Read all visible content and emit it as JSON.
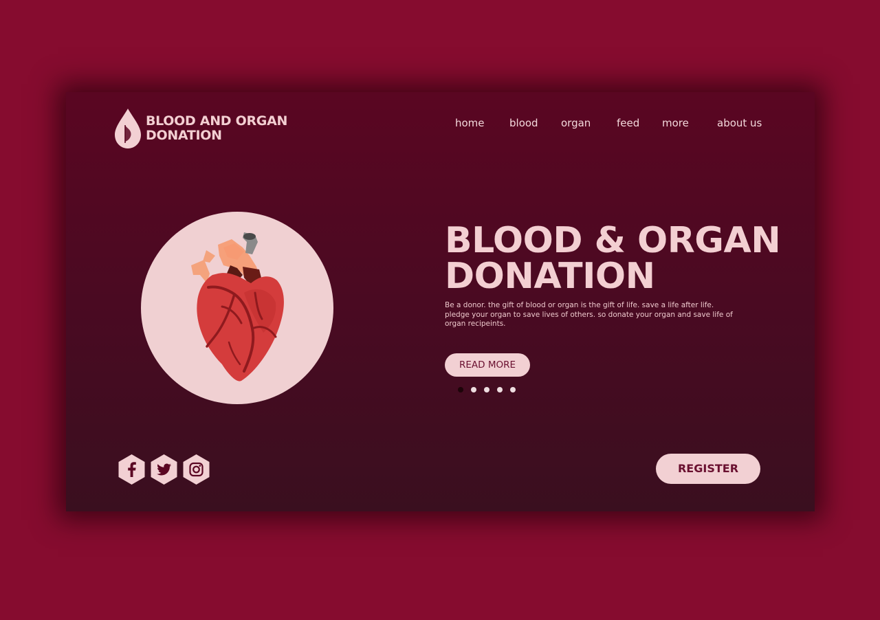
{
  "logo": {
    "line1": "BLOOD AND ORGAN",
    "line2": "DONATION",
    "icon": "blood-drop-icon"
  },
  "nav": {
    "items": [
      "home",
      "blood",
      "organ",
      "feed",
      "more",
      "about us"
    ]
  },
  "hero": {
    "illustration": "heart-icon",
    "title_line1": "BLOOD & ORGAN",
    "title_line2": "DONATION",
    "description": "Be a donor. the gift of blood or organ is the gift of life. save a life after life. pledge your organ to save lives of others. so donate your organ and save life of organ recipeints.",
    "read_more_label": "READ MORE",
    "carousel": {
      "total": 5,
      "active": 1
    }
  },
  "footer": {
    "social": [
      "facebook-icon",
      "twitter-icon",
      "instagram-icon"
    ],
    "register_label": "REGISTER"
  },
  "colors": {
    "page_background": "#860c2f",
    "card_top": "#5a0622",
    "card_bottom": "#3a0f1f",
    "accent_light": "#f2d0d3",
    "accent_dark": "#6a1030"
  }
}
